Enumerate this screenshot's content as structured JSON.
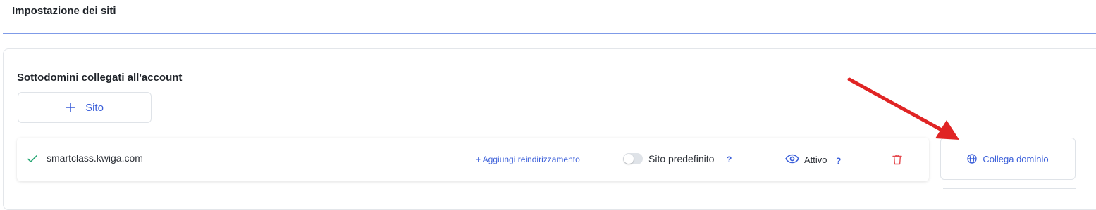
{
  "page": {
    "title": "Impostazione dei siti"
  },
  "subdomains": {
    "heading": "Sottodomini collegati all'account",
    "add_site_label": "Sito",
    "add_site_icon": "plus-icon"
  },
  "site_row": {
    "status_icon": "check-icon",
    "domain": "smartclass.kwiga.com",
    "add_redirect_label": "+ Aggiungi reindirizzamento",
    "default_site_label": "Sito predefinito",
    "default_site_enabled": false,
    "default_help": "?",
    "visibility_icon": "eye-icon",
    "active_label": "Attivo",
    "active_help": "?",
    "delete_icon": "trash-icon"
  },
  "connect_domain": {
    "label": "Collega dominio",
    "icon": "globe-icon"
  },
  "colors": {
    "accent": "#3b5fd9",
    "success": "#2aa876",
    "danger": "#e5484d",
    "annotation_arrow": "#e02424"
  }
}
